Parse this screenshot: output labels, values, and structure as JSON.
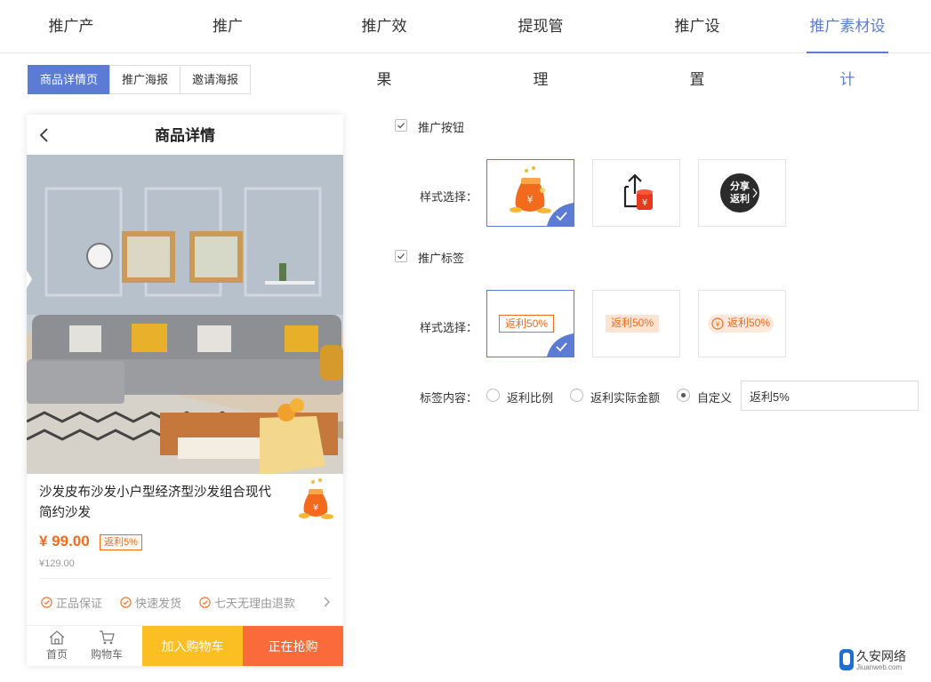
{
  "nav": {
    "tabs": [
      {
        "label": "推广产品"
      },
      {
        "label": "推广员"
      },
      {
        "label": "推广效果"
      },
      {
        "label": "提现管理"
      },
      {
        "label": "推广设置"
      },
      {
        "label": "推广素材设计",
        "active": true
      }
    ]
  },
  "subtabs": [
    {
      "label": "商品详情页",
      "active": true
    },
    {
      "label": "推广海报"
    },
    {
      "label": "邀请海报"
    }
  ],
  "preview": {
    "title": "商品详情",
    "product_name": "沙发皮布沙发小户型经济型沙发组合现代简约沙发",
    "price": "¥ 99.00",
    "tag": "返利5%",
    "original_price": "¥129.00",
    "guarantees": [
      "正品保证",
      "快速发货",
      "七天无理由退款"
    ],
    "nav_home": "首页",
    "nav_cart": "购物车",
    "add_cart": "加入购物车",
    "buy_now": "正在抢购"
  },
  "config": {
    "button_section": {
      "label": "推广按钮",
      "checked": true
    },
    "button_style_label": "样式选择：",
    "button_styles": [
      {
        "icon": "money-bag-icon",
        "selected": true
      },
      {
        "icon": "share-upload-icon",
        "selected": false
      },
      {
        "icon": "share-rebate-circle-icon",
        "text": "分享返利",
        "selected": false
      }
    ],
    "tag_section": {
      "label": "推广标签",
      "checked": true
    },
    "tag_style_label": "样式选择：",
    "tag_styles": [
      {
        "text": "返利50%",
        "selected": true
      },
      {
        "text": "返利50%",
        "selected": false
      },
      {
        "text": "返利50%",
        "selected": false
      }
    ],
    "tag_content_label": "标签内容：",
    "tag_options": [
      {
        "label": "返利比例",
        "selected": false
      },
      {
        "label": "返利实际金额",
        "selected": false
      },
      {
        "label": "自定义",
        "selected": true
      }
    ],
    "custom_value": "返利5%"
  },
  "watermark": {
    "title": "久安网络",
    "sub": "Jiuanweb.com"
  },
  "colors": {
    "accent": "#5b7bd5",
    "orange": "#f26b1d",
    "cart": "#fbbe23",
    "buy": "#fb6a3a"
  }
}
